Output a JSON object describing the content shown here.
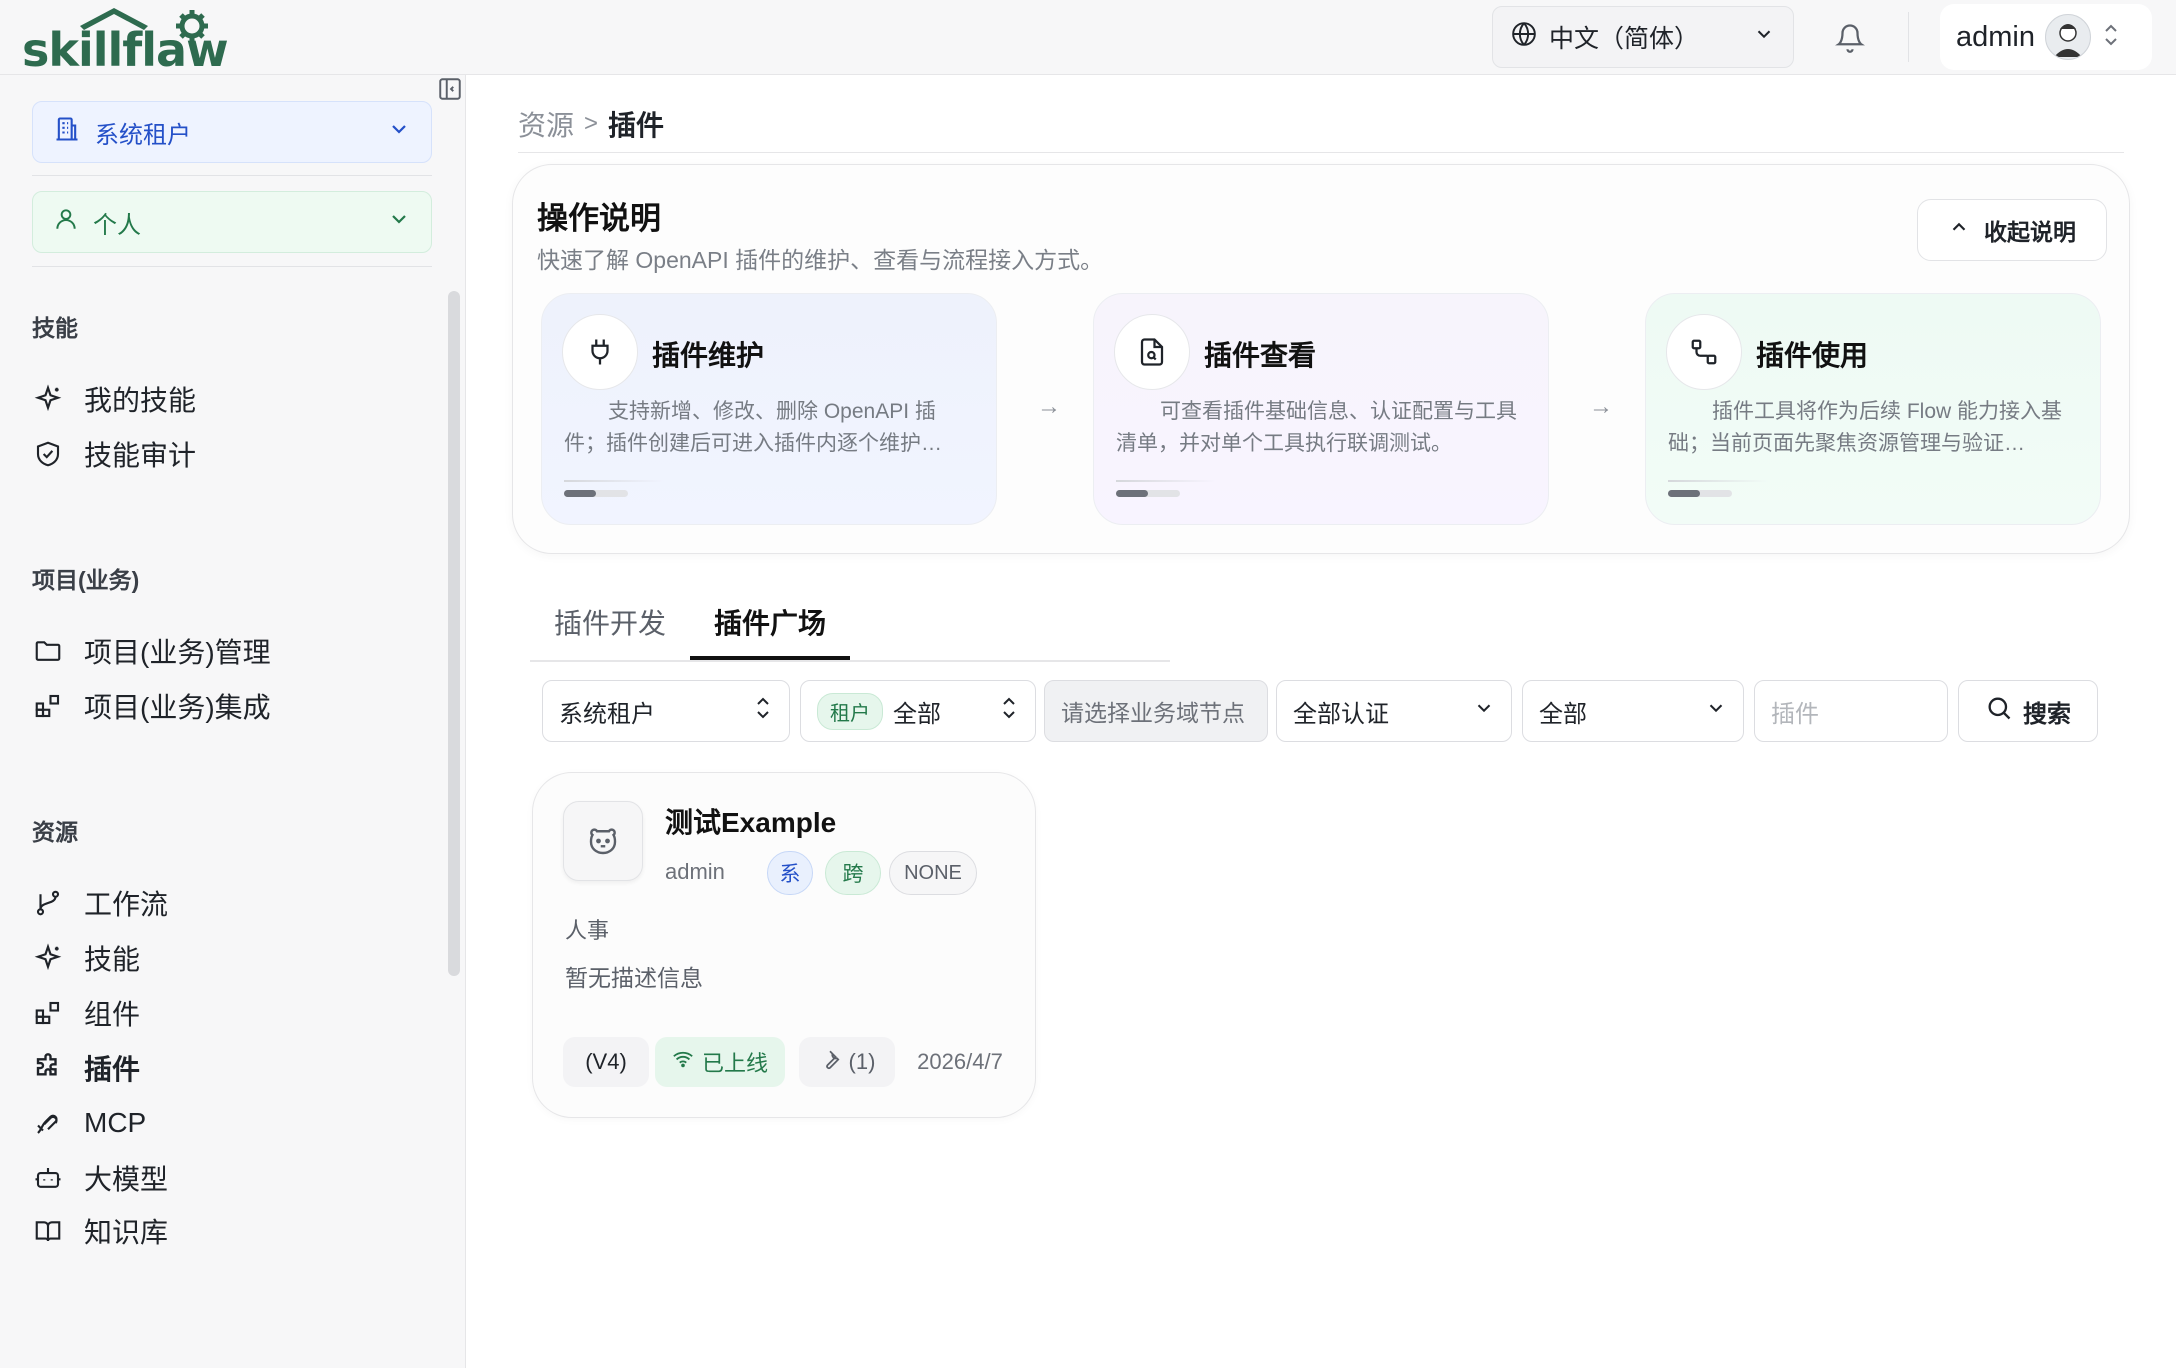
{
  "header": {
    "logo_text": "skillflaw",
    "language": "中文（简体）",
    "user_name": "admin"
  },
  "sidebar": {
    "tenant_scope": "系统租户",
    "personal_scope": "个人",
    "sections": [
      {
        "title": "技能",
        "items": [
          {
            "label": "我的技能",
            "icon": "sparkle-icon"
          },
          {
            "label": "技能审计",
            "icon": "shield-check-icon"
          }
        ]
      },
      {
        "title": "项目(业务)",
        "items": [
          {
            "label": "项目(业务)管理",
            "icon": "folder-icon"
          },
          {
            "label": "项目(业务)集成",
            "icon": "blocks-icon"
          }
        ]
      },
      {
        "title": "资源",
        "items": [
          {
            "label": "工作流",
            "icon": "workflow-icon"
          },
          {
            "label": "技能",
            "icon": "sparkle-icon"
          },
          {
            "label": "组件",
            "icon": "blocks-icon"
          },
          {
            "label": "插件",
            "icon": "puzzle-icon",
            "active": true
          },
          {
            "label": "MCP",
            "icon": "mcp-icon"
          },
          {
            "label": "大模型",
            "icon": "bot-icon"
          },
          {
            "label": "知识库",
            "icon": "book-icon"
          }
        ]
      }
    ]
  },
  "breadcrumb": {
    "parent": "资源",
    "separator": ">",
    "current": "插件"
  },
  "help": {
    "title": "操作说明",
    "subtitle": "快速了解 OpenAPI 插件的维护、查看与流程接入方式。",
    "collapse_label": "收起说明",
    "steps": [
      {
        "title": "插件维护",
        "icon": "plug-icon",
        "desc": "支持新增、修改、删除 OpenAPI 插件；插件创建后可进入插件内逐个维护…"
      },
      {
        "title": "插件查看",
        "icon": "file-search-icon",
        "desc": "可查看插件基础信息、认证配置与工具清单，并对单个工具执行联调测试。"
      },
      {
        "title": "插件使用",
        "icon": "route-icon",
        "desc": "插件工具将作为后续 Flow 能力接入基础；当前页面先聚焦资源管理与验证…"
      }
    ]
  },
  "tabs": [
    {
      "label": "插件开发"
    },
    {
      "label": "插件广场",
      "active": true
    }
  ],
  "filters": {
    "tenant": "系统租户",
    "role_tag": "租户",
    "role_value": "全部",
    "domain_placeholder": "请选择业务域节点",
    "auth": "全部认证",
    "status": "全部",
    "keyword_placeholder": "插件",
    "search_label": "搜索"
  },
  "plugins": [
    {
      "name": "测试Example",
      "author": "admin",
      "badges": {
        "system": "系",
        "cross": "跨",
        "auth": "NONE"
      },
      "category": "人事",
      "description": "暂无描述信息",
      "version": "(V4)",
      "status": "已上线",
      "tools": "(1)",
      "date": "2026/4/7"
    }
  ],
  "colors": {
    "accent_blue": "#2450c8",
    "accent_green": "#23794a",
    "sidebar_bg": "#f7f7f8"
  }
}
